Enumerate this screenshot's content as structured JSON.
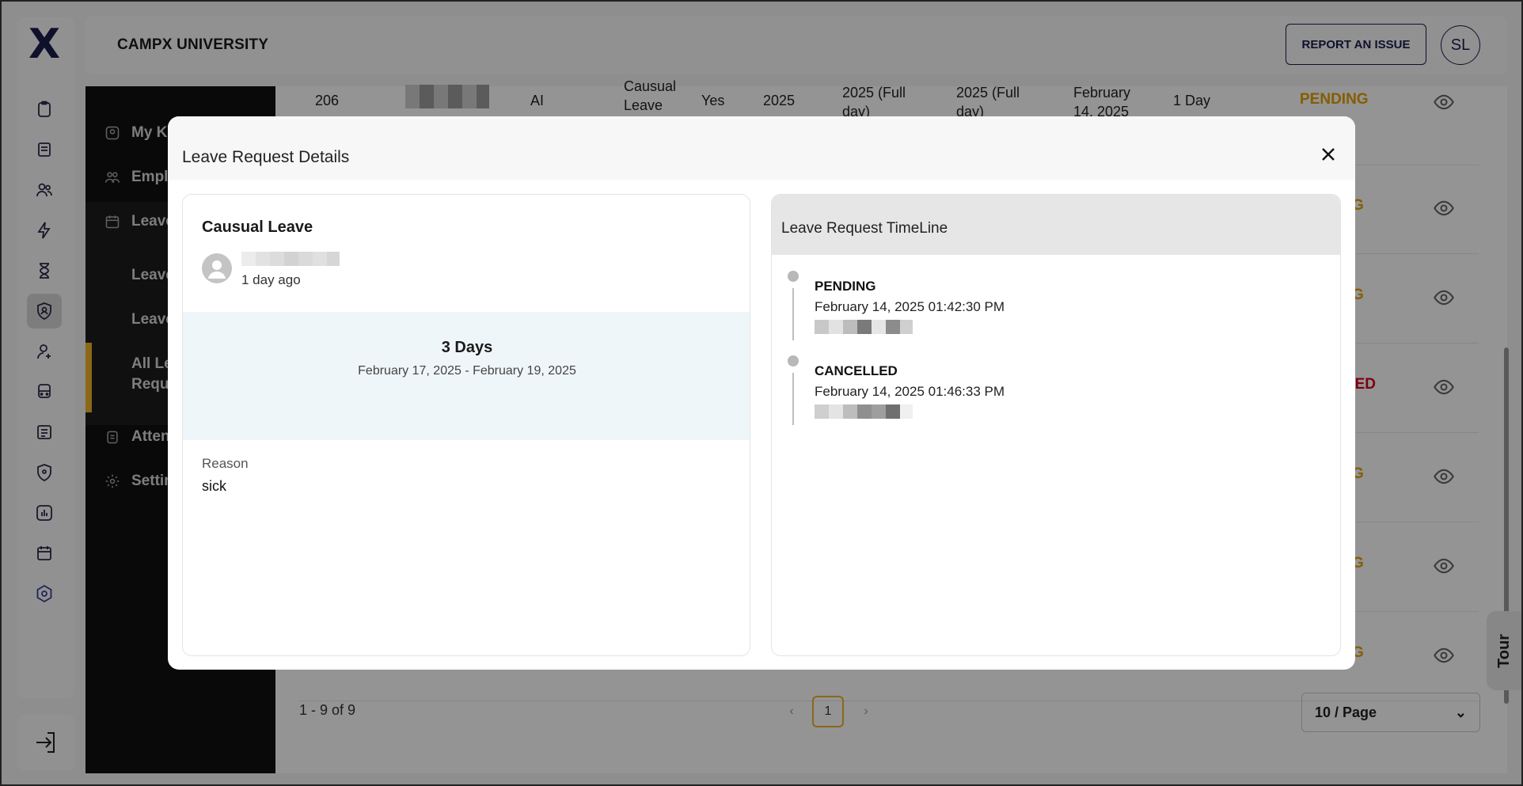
{
  "app": {
    "title": "CAMPX UNIVERSITY",
    "logo": "X"
  },
  "header": {
    "report_label": "REPORT AN ISSUE",
    "avatar_initials": "SL"
  },
  "sidebar": {
    "items": [
      {
        "label": "My Kids",
        "icon": "child-icon"
      },
      {
        "label": "Employees",
        "icon": "users-icon"
      },
      {
        "label": "Leaves",
        "icon": "calendar-icon"
      },
      {
        "label": "Attendance",
        "icon": "attendance-icon"
      },
      {
        "label": "Settings",
        "icon": "gear-icon"
      }
    ],
    "sub_items": [
      {
        "label": "Leave"
      },
      {
        "label": "Leave"
      },
      {
        "label": "All Leave"
      },
      {
        "label": "Requests"
      }
    ]
  },
  "table": {
    "first_row": {
      "id": "206",
      "col3": "AI",
      "leave_type": "Causual Leave",
      "flag": "Yes",
      "year": "2025",
      "from": "2025 (Full day)",
      "to": "2025 (Full day)",
      "applied": "February 14, 2025",
      "duration": "1 Day",
      "status": "PENDING"
    },
    "status_fragments": [
      "G",
      "G",
      "LED",
      "G",
      "G",
      "G"
    ],
    "pagination_info": "1 - 9 of 9",
    "current_page": "1",
    "per_page": "10 / Page"
  },
  "tour_label": "Tour",
  "modal": {
    "title": "Leave Request Details",
    "leave_type": "Causual Leave",
    "time_ago": "1 day ago",
    "days": "3 Days",
    "date_range": "February 17, 2025 - February 19, 2025",
    "reason_label": "Reason",
    "reason_value": "sick",
    "timeline_title": "Leave Request TimeLine",
    "timeline": [
      {
        "status": "PENDING",
        "datetime": "February 14, 2025 01:42:30 PM"
      },
      {
        "status": "CANCELLED",
        "datetime": "February 14, 2025 01:46:33 PM"
      }
    ]
  },
  "colors": {
    "accent": "#f0b429",
    "brand": "#1b1d4d",
    "pending": "#e5a000",
    "cancelled": "#d6001c"
  }
}
